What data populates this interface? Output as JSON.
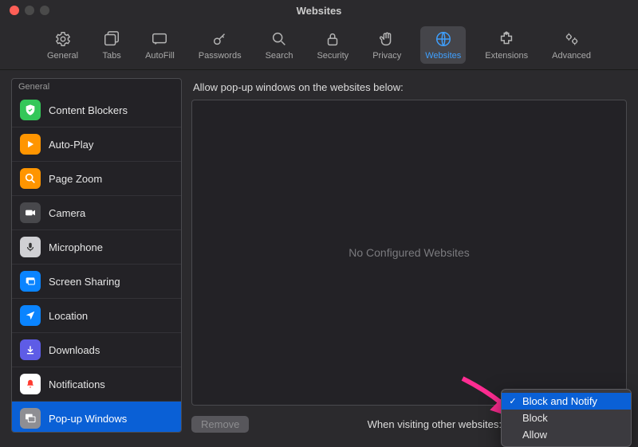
{
  "window": {
    "title": "Websites"
  },
  "toolbar": {
    "items": [
      {
        "label": "General"
      },
      {
        "label": "Tabs"
      },
      {
        "label": "AutoFill"
      },
      {
        "label": "Passwords"
      },
      {
        "label": "Search"
      },
      {
        "label": "Security"
      },
      {
        "label": "Privacy"
      },
      {
        "label": "Websites"
      },
      {
        "label": "Extensions"
      },
      {
        "label": "Advanced"
      }
    ]
  },
  "sidebar": {
    "header": "General",
    "items": [
      {
        "label": "Content Blockers"
      },
      {
        "label": "Auto-Play"
      },
      {
        "label": "Page Zoom"
      },
      {
        "label": "Camera"
      },
      {
        "label": "Microphone"
      },
      {
        "label": "Screen Sharing"
      },
      {
        "label": "Location"
      },
      {
        "label": "Downloads"
      },
      {
        "label": "Notifications"
      },
      {
        "label": "Pop-up Windows"
      }
    ]
  },
  "main": {
    "heading": "Allow pop-up windows on the websites below:",
    "empty": "No Configured Websites",
    "remove": "Remove",
    "footer_label": "When visiting other websites:"
  },
  "dropdown": {
    "items": [
      {
        "label": "Block and Notify"
      },
      {
        "label": "Block"
      },
      {
        "label": "Allow"
      }
    ]
  }
}
